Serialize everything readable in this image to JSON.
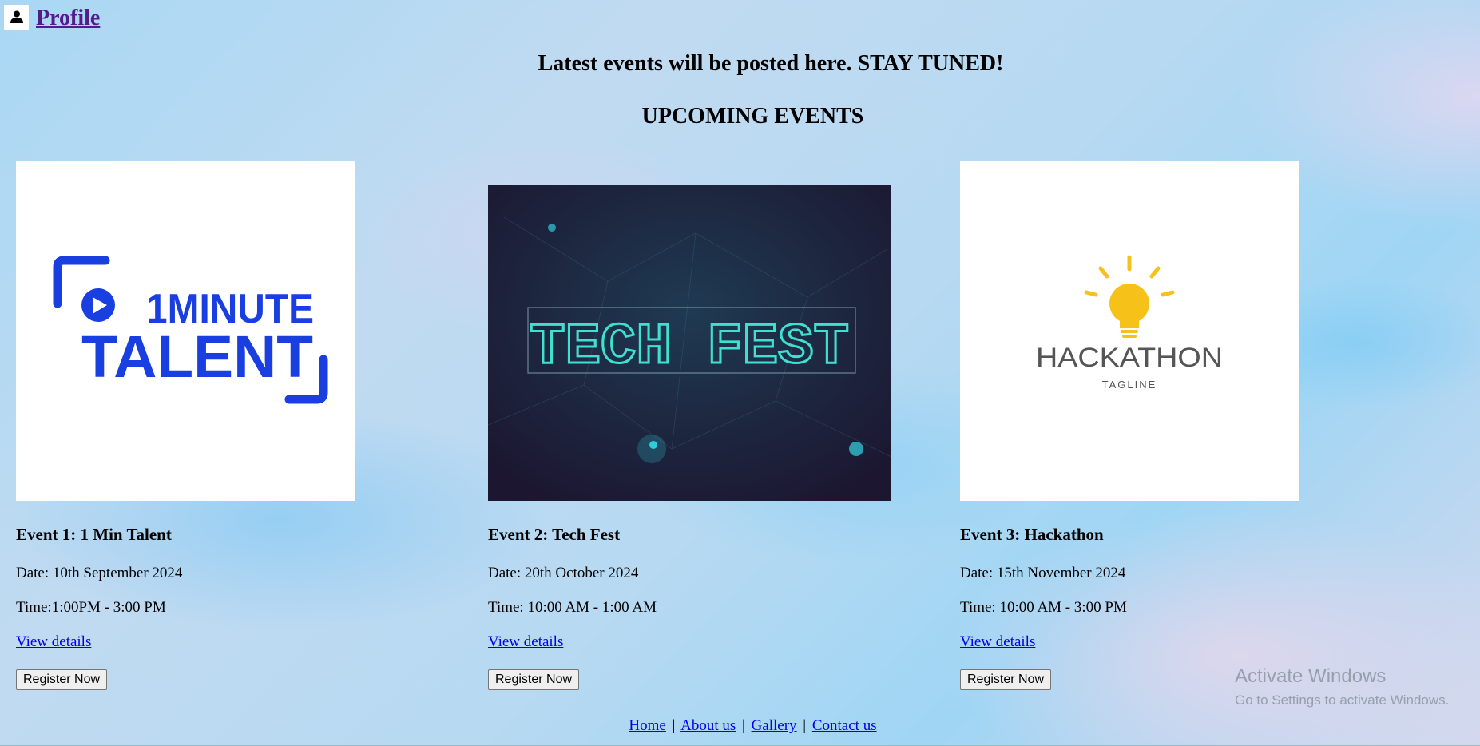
{
  "header": {
    "profile_label": "Profile",
    "profile_icon": "user-icon"
  },
  "headline": "Latest events will be posted here. STAY TUNED!",
  "section_title": "UPCOMING EVENTS",
  "events": [
    {
      "title": "Event 1: 1 Min Talent",
      "date": "Date: 10th September 2024",
      "time": "Time:1:00PM - 3:00 PM",
      "details_link": "View details",
      "register_label": "Register Now",
      "logo": {
        "line1": "1MINUTE",
        "line2": "TALENT",
        "color": "#1a3fe0"
      }
    },
    {
      "title": "Event 2: Tech Fest",
      "date": "Date: 20th October 2024",
      "time": "Time: 10:00 AM - 1:00 AM",
      "details_link": "View details",
      "register_label": "Register Now",
      "logo": {
        "text": "TECH FEST",
        "color": "#3fe0d0"
      }
    },
    {
      "title": "Event 3: Hackathon",
      "date": "Date: 15th November 2024",
      "time": "Time: 10:00 AM - 3:00 PM",
      "details_link": "View details",
      "register_label": "Register Now",
      "logo": {
        "text": "HACKATHON",
        "tagline": "TAGLINE",
        "bulb_color": "#f6c21a"
      }
    }
  ],
  "footer": {
    "links": [
      "Home",
      "About us",
      "Gallery",
      "Contact us"
    ],
    "separator": "|"
  },
  "watermark": {
    "title": "Activate Windows",
    "subtitle": "Go to Settings to activate Windows."
  }
}
